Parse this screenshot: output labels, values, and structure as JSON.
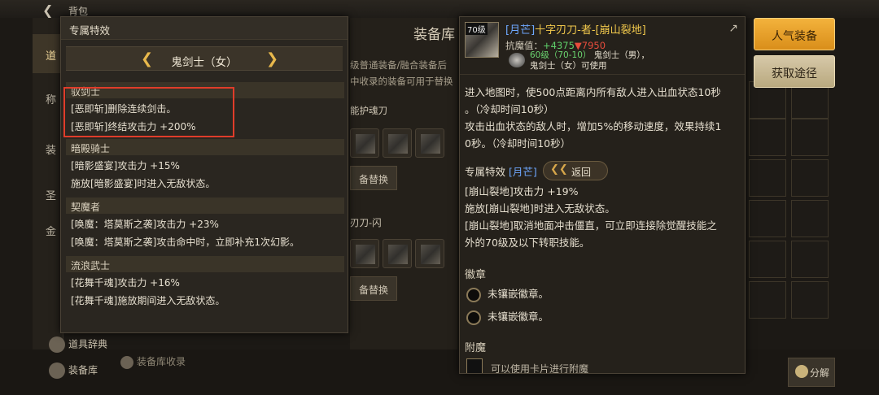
{
  "background": {
    "title": "背包",
    "center_title": "装备库",
    "desc_lines": [
      "级普通装备/融合装备后",
      "中收录的装备可用于替换"
    ],
    "nav_tabs": [
      "道",
      "称",
      "装",
      "圣",
      "金"
    ],
    "row_labels": [
      "能护魂刀",
      "刃刀-闪"
    ],
    "replace_label": "备替换",
    "bottom_items": [
      "道具辞典",
      "装备库",
      "装备库收录"
    ]
  },
  "left_popup": {
    "header": "专属特效",
    "class_name": "鬼剑士（女）",
    "sections": [
      {
        "name": "驭剑士",
        "lines": [
          "[恶即斩]删除连续剑击。",
          "[恶即斩]终结攻击力 +200%"
        ]
      },
      {
        "name": "暗殿骑士",
        "lines": [
          "[暗影盛宴]攻击力 +15%",
          "施放[暗影盛宴]时进入无敌状态。"
        ]
      },
      {
        "name": "契魔者",
        "lines": [
          "[唤魔：塔莫斯之袭]攻击力 +23%",
          "[唤魔：塔莫斯之袭]攻击命中时，立即补充1次幻影。"
        ]
      },
      {
        "name": "流浪武士",
        "lines": [
          "[花舞千魂]攻击力 +16%",
          "[花舞千魂]施放期间进入无敌状态。"
        ]
      }
    ]
  },
  "item_tooltip": {
    "level_tag": "70级",
    "name_tag": "[月芒]",
    "name": "十字刃刀-者-[崩山裂地]",
    "resist_label": "抗魔值：",
    "resist_plus": "+4375",
    "resist_down": "▼7950",
    "level_line": "60级（70-10）",
    "usable_line1": "鬼剑士（男），",
    "usable_line2": "鬼剑士（女）可使用",
    "desc_lines": [
      "进入地图时，使500点距离内所有敌人进入出血状态10秒",
      "。（冷却时间10秒）",
      "攻击出血状态的敌人时，增加5%的移动速度，效果持续1",
      "0秒。（冷却时间10秒）"
    ],
    "exclusive_label": "专属特效",
    "exclusive_tag": "[月芒]",
    "return_label": "返回",
    "effect_lines": [
      "[崩山裂地]攻击力 +19%",
      "施放[崩山裂地]时进入无敌状态。",
      "[崩山裂地]取消地面冲击僵直，可立即连接除觉醒技能之",
      "外的70级及以下转职技能。"
    ],
    "badge_title": "徽章",
    "badge_lines": [
      "未镶嵌徽章。",
      "未镶嵌徽章。"
    ],
    "enchant_title": "附魔",
    "enchant_text": "可以使用卡片进行附魔"
  },
  "right_buttons": {
    "popular": "人气装备",
    "acquire": "获取途径",
    "decompose": "分解"
  },
  "colors": {
    "accent_gold": "#f3b23c",
    "highlight_red": "#e03c2a",
    "tag_blue": "#6ea8ff",
    "item_name": "#f2c94c"
  }
}
